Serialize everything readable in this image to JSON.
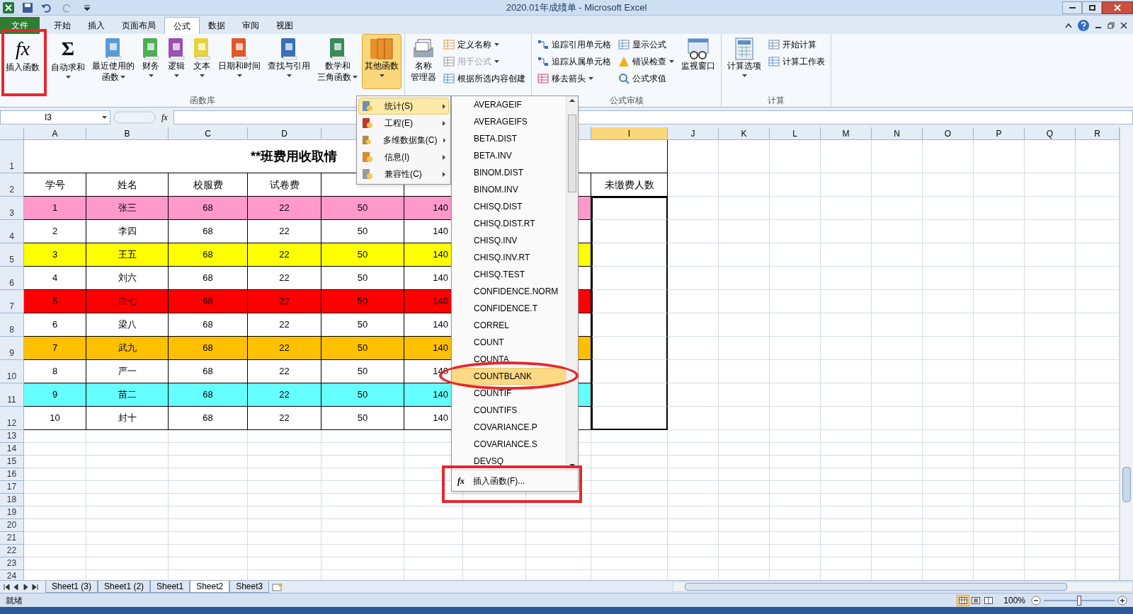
{
  "window": {
    "title": "2020.01年成绩单 - Microsoft Excel"
  },
  "ribbon_tabs": [
    {
      "label": "文件",
      "kind": "file",
      "selected": false
    },
    {
      "label": "开始",
      "kind": "tab",
      "selected": false
    },
    {
      "label": "插入",
      "kind": "tab",
      "selected": false
    },
    {
      "label": "页面布局",
      "kind": "tab",
      "selected": false
    },
    {
      "label": "公式",
      "kind": "tab",
      "selected": true
    },
    {
      "label": "数据",
      "kind": "tab",
      "selected": false
    },
    {
      "label": "审阅",
      "kind": "tab",
      "selected": false
    },
    {
      "label": "视图",
      "kind": "tab",
      "selected": false
    }
  ],
  "ribbon": {
    "groups": [
      {
        "label": "函数库",
        "items": [
          {
            "kind": "insert-function",
            "icon_text": "fx",
            "lines": [
              "插入函数"
            ],
            "dropdown": false,
            "pressed": false
          },
          {
            "kind": "autosum",
            "icon_text": "Σ",
            "lines": [
              "自动求和"
            ],
            "dropdown": true,
            "pressed": false
          },
          {
            "kind": "library",
            "color": "#5b9bd5",
            "lines": [
              "最近使用的",
              "函数"
            ],
            "dropdown": true,
            "pressed": false
          },
          {
            "kind": "library",
            "color": "#4caf50",
            "lines": [
              "财务"
            ],
            "dropdown": true,
            "pressed": false
          },
          {
            "kind": "library",
            "color": "#9b4fb0",
            "lines": [
              "逻辑"
            ],
            "dropdown": true,
            "pressed": false
          },
          {
            "kind": "library",
            "color": "#e8d23a",
            "lines": [
              "文本"
            ],
            "dropdown": true,
            "pressed": false
          },
          {
            "kind": "library",
            "color": "#e0572a",
            "lines": [
              "日期和时间"
            ],
            "dropdown": true,
            "pressed": false
          },
          {
            "kind": "library",
            "color": "#3a6fb8",
            "lines": [
              "查找与引用"
            ],
            "dropdown": true,
            "pressed": false
          },
          {
            "kind": "library",
            "color": "#3a8a5a",
            "lines": [
              "数学和",
              "三角函数"
            ],
            "dropdown": true,
            "pressed": false
          },
          {
            "kind": "other-library",
            "color": "#e8902a",
            "lines": [
              "其他函数"
            ],
            "dropdown": true,
            "pressed": true
          }
        ]
      },
      {
        "items": [
          {
            "kind": "name-manager",
            "lines": [
              "名称",
              "管理器"
            ],
            "dropdown": false,
            "pressed": false
          },
          {
            "kind": "stack",
            "entries": [
              {
                "label": "定义名称",
                "dropdown": true,
                "disabled": false
              },
              {
                "label": "用于公式",
                "dropdown": true,
                "disabled": true
              },
              {
                "label": "根据所选内容创建",
                "dropdown": false,
                "disabled": false
              }
            ]
          }
        ]
      },
      {
        "label": "公式审核",
        "items": [
          {
            "kind": "stack",
            "entries": [
              {
                "label": "追踪引用单元格",
                "dropdown": false,
                "disabled": false
              },
              {
                "label": "追踪从属单元格",
                "dropdown": false,
                "disabled": false
              },
              {
                "label": "移去箭头",
                "dropdown": true,
                "disabled": false
              }
            ]
          },
          {
            "kind": "stack",
            "entries": [
              {
                "label": "显示公式",
                "dropdown": false,
                "disabled": false
              },
              {
                "label": "错误检查",
                "dropdown": true,
                "disabled": false
              },
              {
                "label": "公式求值",
                "dropdown": false,
                "disabled": false
              }
            ]
          },
          {
            "kind": "watch-window",
            "lines": [
              "监视窗口"
            ],
            "dropdown": false,
            "pressed": false
          }
        ]
      },
      {
        "label": "计算",
        "items": [
          {
            "kind": "calc-options",
            "lines": [
              "计算选项"
            ],
            "dropdown": true,
            "pressed": false
          },
          {
            "kind": "stack",
            "entries": [
              {
                "label": "开始计算",
                "dropdown": false,
                "disabled": false
              },
              {
                "label": "计算工作表",
                "dropdown": false,
                "disabled": false
              }
            ]
          }
        ]
      }
    ]
  },
  "formula_bar": {
    "name_box": "I3",
    "fx": "fx"
  },
  "sheet": {
    "columns": [
      {
        "label": "A",
        "selected": false
      },
      {
        "label": "B",
        "selected": false
      },
      {
        "label": "C",
        "selected": false
      },
      {
        "label": "D",
        "selected": false
      },
      {
        "label": "I",
        "selected": true
      },
      {
        "label": "J",
        "selected": false
      },
      {
        "label": "K",
        "selected": false
      },
      {
        "label": "L",
        "selected": false
      },
      {
        "label": "M",
        "selected": false
      },
      {
        "label": "N",
        "selected": false
      },
      {
        "label": "O",
        "selected": false
      },
      {
        "label": "P",
        "selected": false
      },
      {
        "label": "Q",
        "selected": false
      },
      {
        "label": "R",
        "selected": false
      }
    ],
    "title_row": {
      "number": "1",
      "title": "**班费用收取情"
    },
    "header_row": {
      "number": "2",
      "cells": [
        "学号",
        "姓名",
        "校服费",
        "试卷费"
      ],
      "extra": "未缴费人数"
    },
    "rows": [
      {
        "number": "3",
        "color": "#ff99cc",
        "cells": [
          "1",
          "张三",
          "68",
          "22",
          "50",
          "140"
        ]
      },
      {
        "number": "4",
        "color": "#ffffff",
        "cells": [
          "2",
          "李四",
          "68",
          "22",
          "50",
          "140"
        ]
      },
      {
        "number": "5",
        "color": "#ffff00",
        "cells": [
          "3",
          "王五",
          "68",
          "22",
          "50",
          "140"
        ]
      },
      {
        "number": "6",
        "color": "#ffffff",
        "cells": [
          "4",
          "刘六",
          "68",
          "22",
          "50",
          "140"
        ]
      },
      {
        "number": "7",
        "color": "#ff0000",
        "cells": [
          "5",
          "白七",
          "68",
          "22",
          "50",
          "140"
        ]
      },
      {
        "number": "8",
        "color": "#ffffff",
        "cells": [
          "6",
          "梁八",
          "68",
          "22",
          "50",
          "140"
        ]
      },
      {
        "number": "9",
        "color": "#ffc000",
        "cells": [
          "7",
          "武九",
          "68",
          "22",
          "50",
          "140"
        ]
      },
      {
        "number": "10",
        "color": "#ffffff",
        "cells": [
          "8",
          "严一",
          "68",
          "22",
          "50",
          "140"
        ]
      },
      {
        "number": "11",
        "color": "#66ffff",
        "cells": [
          "9",
          "苗二",
          "68",
          "22",
          "50",
          "140"
        ]
      },
      {
        "number": "12",
        "color": "#ffffff",
        "cells": [
          "10",
          "封十",
          "68",
          "22",
          "50",
          "140"
        ]
      }
    ],
    "empty_rows": [
      "13",
      "14",
      "15",
      "16",
      "17",
      "18",
      "19",
      "20",
      "21",
      "22",
      "23",
      "24"
    ]
  },
  "menu": {
    "categories": [
      {
        "label": "统计(S)",
        "selected": true
      },
      {
        "label": "工程(E)",
        "selected": false
      },
      {
        "label": "多维数据集(C)",
        "selected": false
      },
      {
        "label": "信息(I)",
        "selected": false
      },
      {
        "label": "兼容性(C)",
        "selected": false
      }
    ],
    "functions": [
      {
        "name": "AVERAGEIF",
        "selected": false
      },
      {
        "name": "AVERAGEIFS",
        "selected": false
      },
      {
        "name": "BETA.DIST",
        "selected": false
      },
      {
        "name": "BETA.INV",
        "selected": false
      },
      {
        "name": "BINOM.DIST",
        "selected": false
      },
      {
        "name": "BINOM.INV",
        "selected": false
      },
      {
        "name": "CHISQ.DIST",
        "selected": false
      },
      {
        "name": "CHISQ.DIST.RT",
        "selected": false
      },
      {
        "name": "CHISQ.INV",
        "selected": false
      },
      {
        "name": "CHISQ.INV.RT",
        "selected": false
      },
      {
        "name": "CHISQ.TEST",
        "selected": false
      },
      {
        "name": "CONFIDENCE.NORM",
        "selected": false
      },
      {
        "name": "CONFIDENCE.T",
        "selected": false
      },
      {
        "name": "CORREL",
        "selected": false
      },
      {
        "name": "COUNT",
        "selected": false
      },
      {
        "name": "COUNTA",
        "selected": false
      },
      {
        "name": "COUNTBLANK",
        "selected": true
      },
      {
        "name": "COUNTIF",
        "selected": false
      },
      {
        "name": "COUNTIFS",
        "selected": false
      },
      {
        "name": "COVARIANCE.P",
        "selected": false
      },
      {
        "name": "COVARIANCE.S",
        "selected": false
      },
      {
        "name": "DEVSQ",
        "selected": false
      }
    ],
    "footer": {
      "icon_text": "fx",
      "label": "插入函数(F)..."
    }
  },
  "annotations": [
    {
      "kind": "box"
    },
    {
      "kind": "oval"
    },
    {
      "kind": "box"
    }
  ],
  "sheet_tabs": [
    {
      "label": "Sheet1 (3)",
      "selected": false
    },
    {
      "label": "Sheet1 (2)",
      "selected": false
    },
    {
      "label": "Sheet1",
      "selected": false
    },
    {
      "label": "Sheet2",
      "selected": true
    },
    {
      "label": "Sheet3",
      "selected": false
    }
  ],
  "status_bar": {
    "status": "就绪",
    "views": [
      {
        "kind": "normal",
        "selected": true
      },
      {
        "kind": "layout",
        "selected": false
      },
      {
        "kind": "pagebreak",
        "selected": false
      }
    ],
    "zoom": "100%",
    "zoom_slider": {
      "level": 0.5
    }
  }
}
